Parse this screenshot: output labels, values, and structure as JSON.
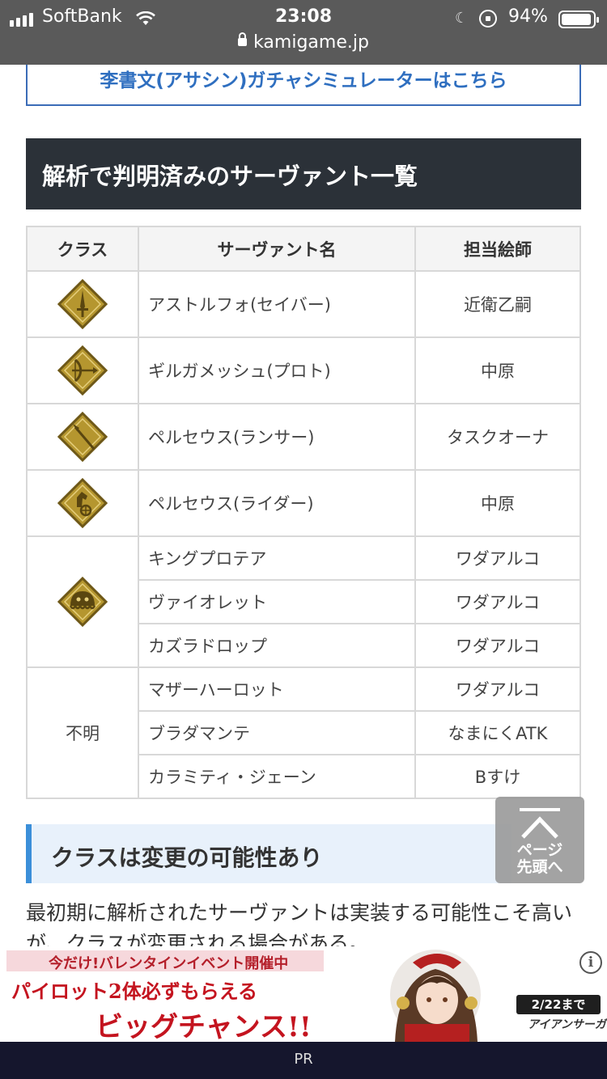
{
  "status_bar": {
    "carrier": "SoftBank",
    "time": "23:08",
    "battery": "94%"
  },
  "url_bar": {
    "domain": "kamigame.jp"
  },
  "link": {
    "label": "李書文(アサシン)ガチャシミュレーターはこちら"
  },
  "section": {
    "title": "解析で判明済みのサーヴァント一覧"
  },
  "table": {
    "headers": {
      "class": "クラス",
      "name": "サーヴァント名",
      "artist": "担当絵師"
    },
    "rows": [
      {
        "class_icon": "saber-class-icon",
        "name": "アストルフォ(セイバー)",
        "artist": "近衛乙嗣"
      },
      {
        "class_icon": "archer-class-icon",
        "name": "ギルガメッシュ(プロト)",
        "artist": "中原"
      },
      {
        "class_icon": "lancer-class-icon",
        "name": "ペルセウス(ランサー)",
        "artist": "タスクオーナ"
      },
      {
        "class_icon": "rider-class-icon",
        "name": "ペルセウス(ライダー)",
        "artist": "中原"
      },
      {
        "class_icon": "foreigner-class-icon",
        "name": "キングプロテア",
        "artist": "ワダアルコ"
      },
      {
        "name": "ヴァイオレット",
        "artist": "ワダアルコ"
      },
      {
        "name": "カズラドロップ",
        "artist": "ワダアルコ"
      },
      {
        "class_text": "不明",
        "name": "マザーハーロット",
        "artist": "ワダアルコ"
      },
      {
        "name": "ブラダマンテ",
        "artist": "なまにくATK"
      },
      {
        "name": "カラミティ・ジェーン",
        "artist": "Bすけ"
      }
    ]
  },
  "sub_section": {
    "title": "クラスは変更の可能性あり"
  },
  "body": {
    "text": "最初期に解析されたサーヴァントは実装する可能性こそ高いが、クラスが変更される場合がある。"
  },
  "scroll_top": {
    "label_1": "ページ",
    "label_2": "先頭へ"
  },
  "ad": {
    "strip": "今だけ!バレンタインイベント開催中",
    "line1": "パイロット2体必ずもらえる",
    "line2": "ビッグチャンス!!",
    "date": "2/22まで",
    "logo": "アイアンサーガ",
    "info_icon": "info-icon"
  },
  "footer": {
    "label": "PR"
  },
  "colors": {
    "topbar": "#5a5a5a",
    "link": "#2f6fc0",
    "section_head_bg": "#2b3138",
    "sub_head_bg": "#e8f1fb",
    "sub_head_accent": "#3b8fd9",
    "class_icon_gold": "#b5962f",
    "ad_red": "#c4141f"
  }
}
